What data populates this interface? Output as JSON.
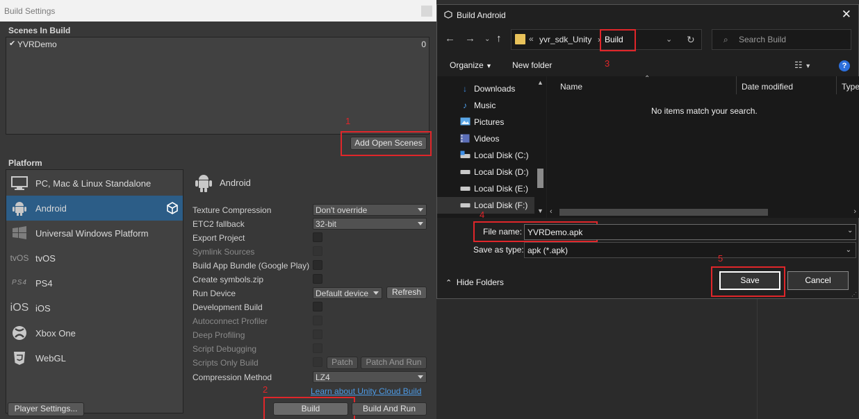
{
  "build_settings": {
    "title": "Build Settings",
    "scenes_label": "Scenes In Build",
    "scenes": [
      {
        "name": "YVRDemo",
        "index": "0",
        "checked": true
      }
    ],
    "add_open_scenes": "Add Open Scenes",
    "platform_label": "Platform",
    "platforms": [
      {
        "label": "PC, Mac & Linux Standalone",
        "icon": "monitor-icon"
      },
      {
        "label": "Android",
        "icon": "android-icon",
        "selected": true
      },
      {
        "label": "Universal Windows Platform",
        "icon": "windows-icon"
      },
      {
        "label": "tvOS",
        "icon": "tvos-icon"
      },
      {
        "label": "PS4",
        "icon": "ps4-icon"
      },
      {
        "label": "iOS",
        "icon": "ios-icon"
      },
      {
        "label": "Xbox One",
        "icon": "xbox-icon"
      },
      {
        "label": "WebGL",
        "icon": "html5-icon"
      }
    ],
    "platform_logo_text": {
      "tvos": "tvOS",
      "ps4": "PS4",
      "ios": "iOS"
    },
    "selected_platform": "Android",
    "settings": {
      "texture_compression": {
        "label": "Texture Compression",
        "value": "Don't override"
      },
      "etc2_fallback": {
        "label": "ETC2 fallback",
        "value": "32-bit"
      },
      "export_project": "Export Project",
      "symlink_sources": "Symlink Sources",
      "build_app_bundle": "Build App Bundle (Google Play)",
      "create_symbols": "Create symbols.zip",
      "run_device": {
        "label": "Run Device",
        "value": "Default device",
        "refresh": "Refresh"
      },
      "development_build": "Development Build",
      "autoconnect_profiler": "Autoconnect Profiler",
      "deep_profiling": "Deep Profiling",
      "script_debugging": "Script Debugging",
      "scripts_only_build": {
        "label": "Scripts Only Build",
        "patch": "Patch",
        "patch_and_run": "Patch And Run"
      },
      "compression_method": {
        "label": "Compression Method",
        "value": "LZ4"
      }
    },
    "cloud_link": "Learn about Unity Cloud Build",
    "player_settings": "Player Settings...",
    "build": "Build",
    "build_and_run": "Build And Run"
  },
  "save_dialog": {
    "title": "Build Android",
    "address": {
      "overflow": "«",
      "segments": [
        "yvr_sdk_Unity",
        "Build"
      ]
    },
    "search_placeholder": "Search Build",
    "toolbar": {
      "organize": "Organize",
      "new_folder": "New folder",
      "help": "?"
    },
    "nav_items": [
      {
        "label": "Downloads",
        "icon": "download-icon"
      },
      {
        "label": "Music",
        "icon": "music-icon"
      },
      {
        "label": "Pictures",
        "icon": "pictures-icon"
      },
      {
        "label": "Videos",
        "icon": "videos-icon"
      },
      {
        "label": "Local Disk (C:)",
        "icon": "disk-icon"
      },
      {
        "label": "Local Disk (D:)",
        "icon": "disk-icon"
      },
      {
        "label": "Local Disk (E:)",
        "icon": "disk-icon"
      },
      {
        "label": "Local Disk (F:)",
        "icon": "disk-icon",
        "selected": true
      }
    ],
    "columns": [
      "Name",
      "Date modified",
      "Type"
    ],
    "empty_message": "No items match your search.",
    "file_name": {
      "label": "File name:",
      "value": "YVRDemo.apk"
    },
    "save_as_type": {
      "label": "Save as type:",
      "value": "apk (*.apk)"
    },
    "hide_folders": "Hide Folders",
    "save": "Save",
    "cancel": "Cancel"
  },
  "annotations": [
    "1",
    "2",
    "3",
    "4",
    "5"
  ],
  "colors": {
    "highlight": "#e0262a",
    "selection": "#2c5d87",
    "link": "#4d9be6"
  }
}
